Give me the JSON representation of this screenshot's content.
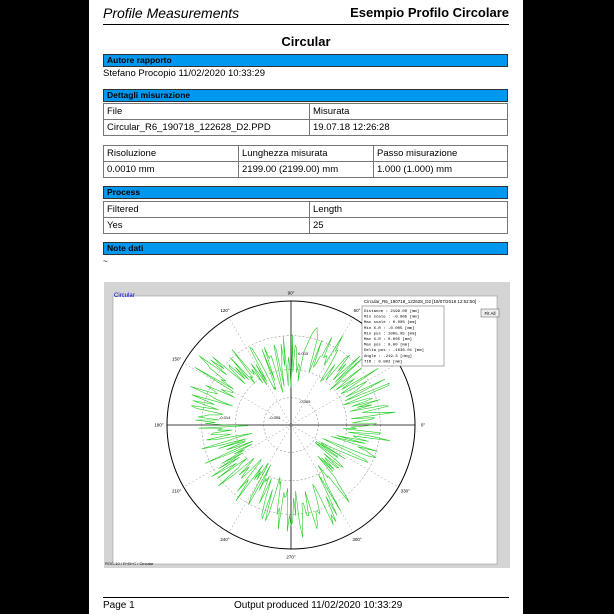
{
  "header": {
    "left_title": "Profile Measurements",
    "right_title": "Esempio Profilo Circolare"
  },
  "report_title": "Circular",
  "author_section": {
    "heading": "Autore  rapporto",
    "value": "Stefano Procopio 11/02/2020 10:33:29"
  },
  "measurement_section": {
    "heading": "Dettagli misurazione",
    "file_label": "File",
    "measured_label": "Misurata",
    "file_value": "Circular_R6_190718_122628_D2.PPD",
    "measured_value": "19.07.18  12:26:28",
    "resolution_label": "Risoluzione",
    "length_label": "Lunghezza misurata",
    "step_label": "Passo misurazione",
    "resolution_value": "0.0010  mm",
    "length_value": "2199.00 (2199.00) mm",
    "step_value": "1.000 (1.000) mm"
  },
  "process_section": {
    "heading": "Process",
    "col1_label": "Filtered",
    "col2_label": "Length",
    "col1_value": "Yes",
    "col2_value": "25"
  },
  "notes_section": {
    "heading": "Note dati",
    "value": "~"
  },
  "plot": {
    "label": "Circular",
    "file_label": "Circular_R6_190718_122628_D2 [18/07/2018 12:52:50]",
    "button_label": "Fit All",
    "angles": [
      "0°",
      "30°",
      "60°",
      "90°",
      "120°",
      "150°",
      "180°",
      "210°",
      "240°",
      "270°",
      "300°",
      "330°"
    ],
    "ring_labels": [
      "0.003",
      "-0.005",
      "-0.014",
      "-0.005"
    ],
    "stats": [
      "Distance  : 2199.00 [mm]",
      "Min scale : -0.005 [mm]",
      "Max scale : 0.005 [mm]",
      "Min X-R   : -0.005 [mm]",
      "Min pos   : 1005.05 [mm]",
      "Max X-R   : 0.005 [mm]",
      "Max pos   : 0.00 [mm]",
      "Delta pos : -1036.01 [mm]",
      "Angle     : -219.3 [deg]",
      "TIR       : 0.002 [mm]"
    ],
    "status": "ROC-10 / R+B+C / Circular",
    "trace_color": "#22cc22"
  },
  "footer": {
    "page": "Page 1",
    "output": "Output produced 11/02/2020 10:33:29"
  }
}
